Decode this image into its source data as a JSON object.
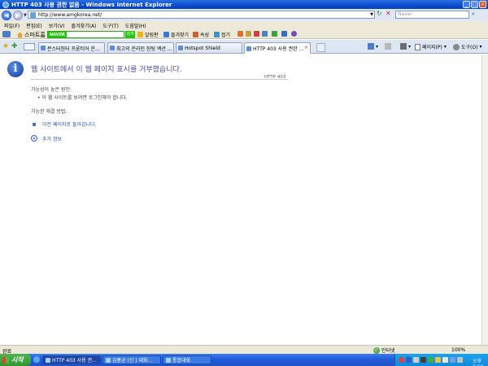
{
  "window": {
    "title": "HTTP 403 사용 권한 없음 - Windows Internet Explorer",
    "buttons": [
      "_",
      "□",
      "×"
    ]
  },
  "address": {
    "url": "http://www.amgkorea.net/",
    "search_placeholder": "Naver"
  },
  "menu": [
    "파일(F)",
    "편집(E)",
    "보기(V)",
    "즐겨찾기(A)",
    "도구(T)",
    "도움말(H)"
  ],
  "toolbar": {
    "home_label": "스마트홈",
    "naver_logo": "NAVER",
    "naver_search_btn": "검색",
    "links": [
      "알림판",
      "즐겨찾기",
      "속성",
      "접기"
    ]
  },
  "tabs": [
    {
      "label": "몬스터헌터 프론티어 온..."
    },
    {
      "label": "최고의 온라인 헌팅 액션 ..."
    },
    {
      "label": "Hotspot Shield"
    },
    {
      "label": "HTTP 403 사용 권한 ..."
    }
  ],
  "commandbar": {
    "page_label": "페이지(P)",
    "tools_label": "도구(O)"
  },
  "error": {
    "title": "웹 사이트에서 이 웹 페이지 표시를 거부했습니다.",
    "code": "HTTP 403",
    "cause_label": "가능성이 높은 원인:",
    "cause_item": "이 웹 사이트를 보려면 로그인해야 합니다.",
    "solution_label": "가능한 해결 방법:",
    "back_link": "이전 페이지로 돌아갑니다.",
    "more_info": "추가 정보"
  },
  "status": {
    "text": "완료",
    "zone": "인터넷",
    "zoom": "100%"
  },
  "taskbar": {
    "start_label": "시작",
    "buttons": [
      {
        "label": "HTTP 403 사용 권..."
      },
      {
        "label": "김홍균 (신 ) 대화..."
      },
      {
        "label": "통합대화"
      }
    ],
    "clock": "오후 3:50"
  }
}
